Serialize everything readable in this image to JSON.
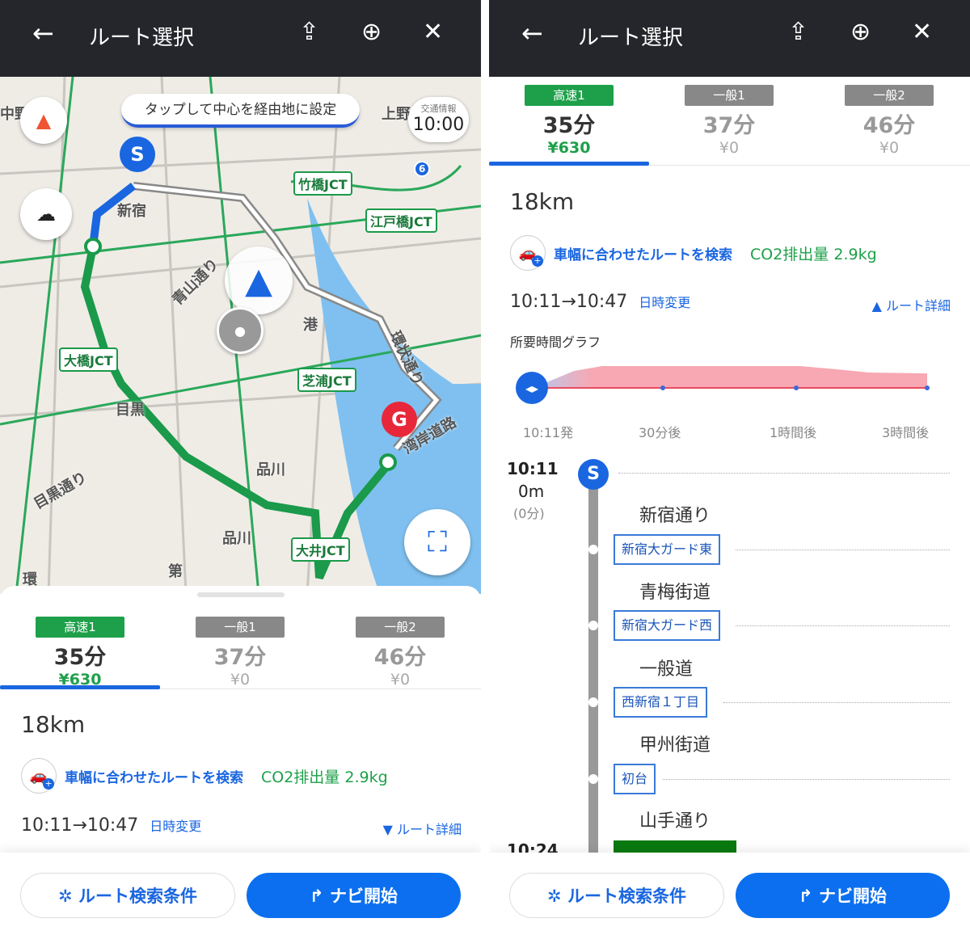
{
  "header": {
    "title": "ルート選択",
    "back_icon": "arrow-left-icon",
    "share_icon": "share-icon",
    "add_pin_icon": "map-pin-plus-icon",
    "close_icon": "close-icon"
  },
  "map": {
    "tip": "タップして中心を経由地に設定",
    "traffic_label": "交通情報",
    "traffic_time": "10:00",
    "start_pin": "S",
    "goal_pin": "G",
    "route_shield": "6",
    "labels": [
      "中野",
      "新宿",
      "上野",
      "港",
      "目黒",
      "品川",
      "品川",
      "目黒通り",
      "青山通り",
      "環状通り",
      "湾岸道路",
      "第",
      "環"
    ],
    "jcts": [
      "竹橋JCT",
      "江戸橋JCT",
      "大橋JCT",
      "芝浦JCT",
      "大井JCT"
    ]
  },
  "routes": [
    {
      "badge": "高速1",
      "duration": "35分",
      "fee": "¥630",
      "selected": true
    },
    {
      "badge": "一般1",
      "duration": "37分",
      "fee": "¥0",
      "selected": false
    },
    {
      "badge": "一般2",
      "duration": "46分",
      "fee": "¥0",
      "selected": false
    }
  ],
  "summary": {
    "distance": "18km",
    "car_search": "車幅に合わせたルートを検索",
    "co2": "CO2排出量 2.9kg",
    "times": "10:11→10:47",
    "change_time": "日時変更",
    "route_detail_collapsed": "▼ ルート詳細",
    "route_detail_expanded": "▲ ルート詳細"
  },
  "graph": {
    "title": "所要時間グラフ",
    "ticks": [
      "10:11発",
      "30分後",
      "1時間後",
      "3時間後"
    ]
  },
  "timeline": {
    "start_time": "10:11",
    "start_dist": "0m",
    "start_min": "(0分)",
    "start_pin": "S",
    "next_time": "10:24",
    "roads": [
      "新宿通り",
      "青梅街道",
      "一般道",
      "甲州街道",
      "山手通り"
    ],
    "places": [
      "新宿大ガード東",
      "新宿大ガード西",
      "西新宿１丁目",
      "初台"
    ]
  },
  "buttons": {
    "search_conditions": "ルート検索条件",
    "navi_start": "ナビ開始"
  },
  "colors": {
    "header": "#24262b",
    "accent": "#1a66e0",
    "highway": "#1ea04a",
    "graph_fill": "#f7a8b2"
  }
}
